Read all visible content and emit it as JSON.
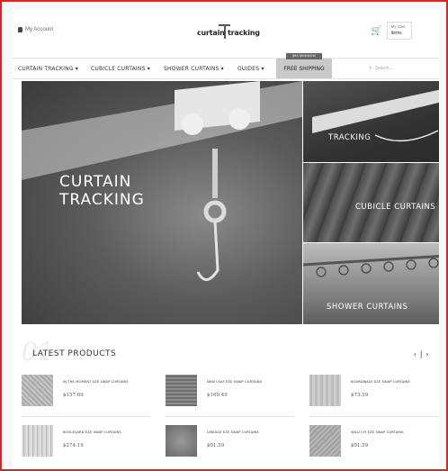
{
  "header": {
    "account_label": "My Account",
    "logo_left": "curtain",
    "logo_right": "tracking",
    "cart_label": "My Cart",
    "cart_items": "Items"
  },
  "nav": {
    "items": [
      "CURTAIN TRACKING ▾",
      "CUBICLE CURTAINS ▾",
      "SHOWER CURTAINS ▾",
      "GUIDES ▾"
    ],
    "free_shipping": "FREE SHIPPING",
    "free_shipping_badge": "$99 MINIMUM",
    "search_placeholder": "Search..."
  },
  "hero": {
    "main_title": "CURTAIN\nTRACKING",
    "panels": [
      "TRACKING",
      "CUBICLE CURTAINS",
      "SHOWER CURTAINS"
    ]
  },
  "products_section": {
    "number": "01",
    "title": "LATEST PRODUCTS",
    "prev": "‹",
    "sep": "|",
    "next": "›"
  },
  "products": [
    {
      "name": "IN THE MOMENT EZE SWAP CURTAINS",
      "price": "$157.69",
      "thumb_color": "#b9b9b9"
    },
    {
      "name": "NEW LEAF EZE SWAP CURTAINS",
      "price": "$169.49",
      "thumb_color": "#7a7a7a"
    },
    {
      "name": "BOARDWALK EZE SWAP CURTAINS",
      "price": "$73.59",
      "thumb_color": "#c3c3c3"
    },
    {
      "name": "BOULEVARD EZE SWAP CURTAINS",
      "price": "$274.19",
      "thumb_color": "#d0d0d0"
    },
    {
      "name": "LINEAGE EZE SWAP CURTAINS",
      "price": "$91.59",
      "thumb_color": "#8c8c8c"
    },
    {
      "name": "WILD IVY EZE SWAP CURTAINS",
      "price": "$91.59",
      "thumb_color": "#a8a8a8"
    }
  ]
}
